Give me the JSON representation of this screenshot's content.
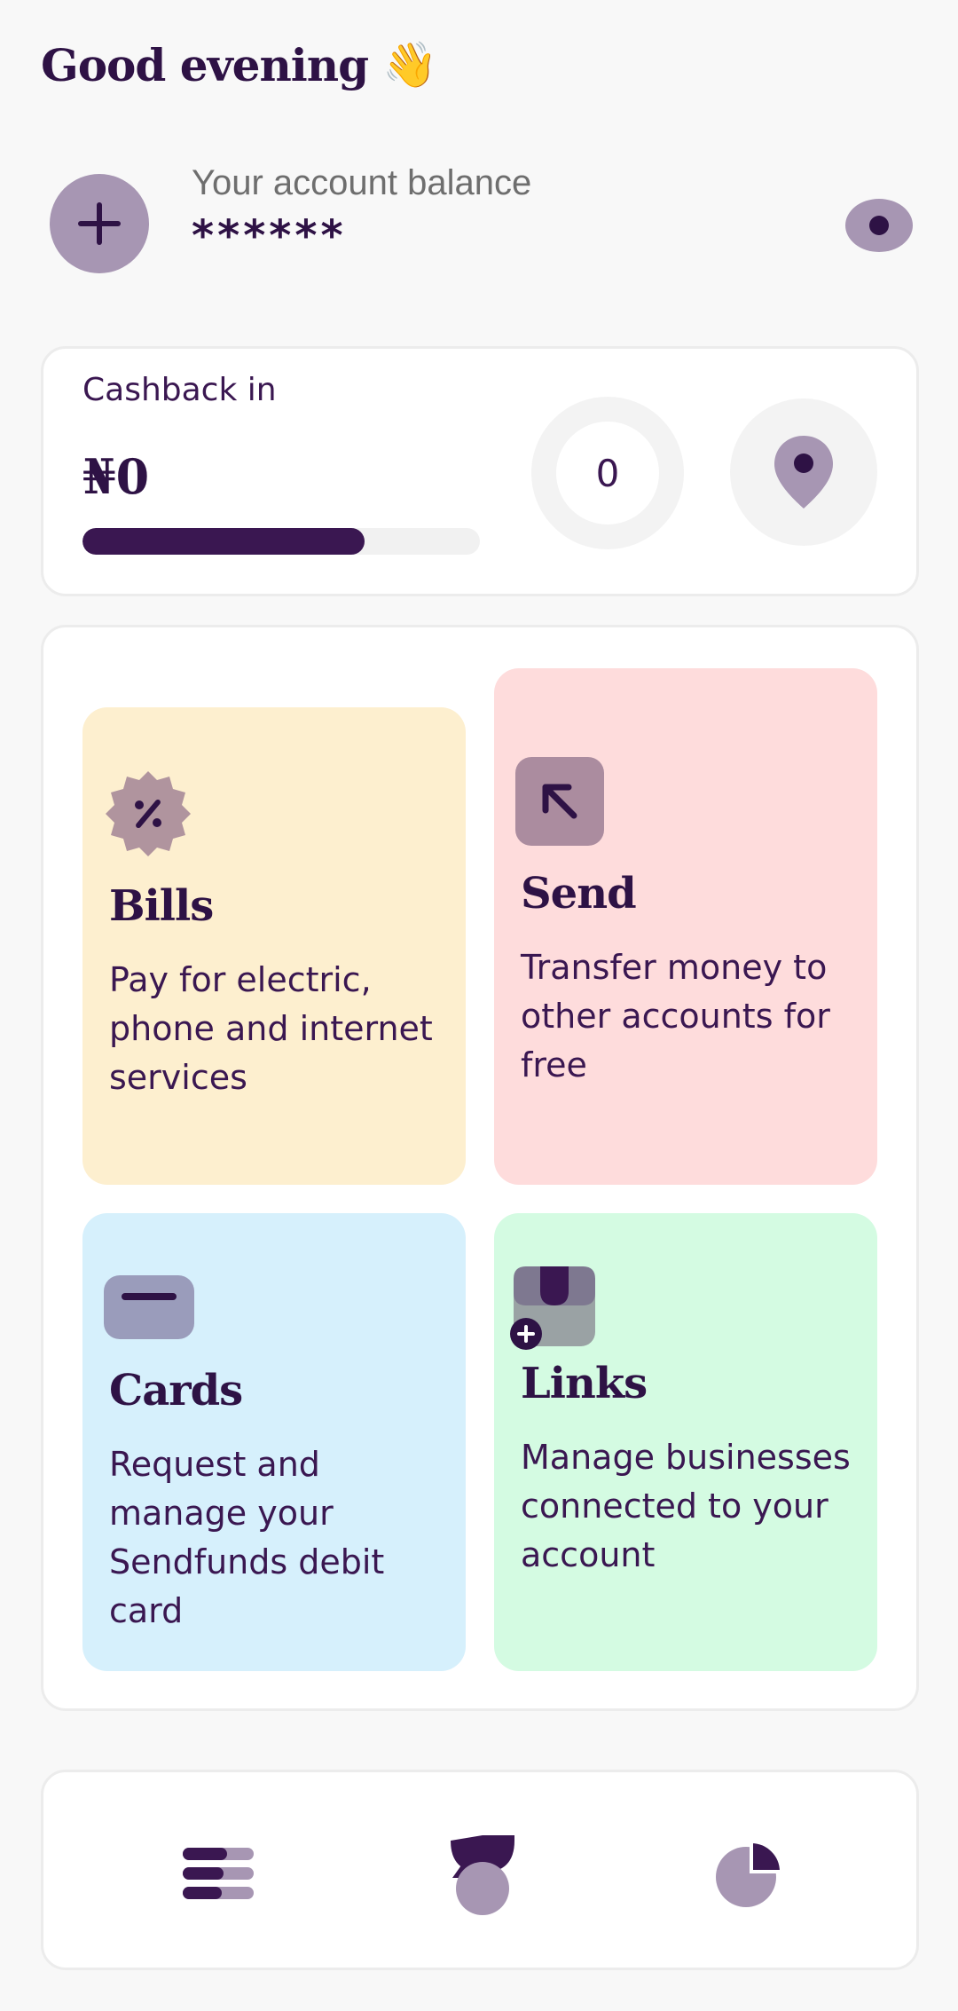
{
  "header": {
    "greeting": "Good evening",
    "greeting_emoji": "👋"
  },
  "balance": {
    "label": "Your account balance",
    "value": "******",
    "add_icon": "plus-icon",
    "visibility_icon": "eye-icon"
  },
  "cashback": {
    "label": "Cashback in",
    "amount": "₦0",
    "progress_percent": 71,
    "counter": "0",
    "pin_icon": "map-pin-icon"
  },
  "services": [
    {
      "title": "Bills",
      "description": "Pay for electric, phone and internet services",
      "icon": "discount-badge-icon",
      "color": "#fdefcf"
    },
    {
      "title": "Send",
      "description": "Transfer money to other accounts for free",
      "icon": "arrow-up-left-icon",
      "color": "#fedcdc"
    },
    {
      "title": "Cards",
      "description": "Request and manage your Sendfunds debit card",
      "icon": "card-icon",
      "color": "#d6f0fc"
    },
    {
      "title": "Links",
      "description": "Manage businesses connected to your account",
      "icon": "store-add-icon",
      "color": "#d4fbe2"
    }
  ],
  "bottom_nav": {
    "items": [
      "menu-icon",
      "sendfunds-logo-icon",
      "pie-chart-icon"
    ]
  },
  "colors": {
    "primary": "#3a1751",
    "muted_purple": "#a796b3",
    "background": "#f8f8f8"
  }
}
